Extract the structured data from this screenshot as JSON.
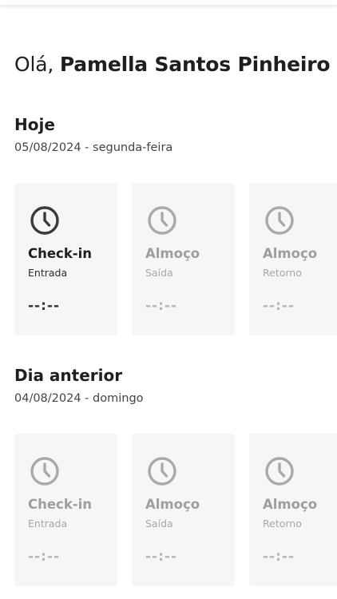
{
  "greeting": {
    "prefix": "Olá, ",
    "name": "Pamella Santos Pinheiro"
  },
  "today": {
    "title": "Hoje",
    "date": "05/08/2024 - segunda-feira",
    "cards": [
      {
        "label": "Check-in",
        "sublabel": "Entrada",
        "time": "--:--",
        "icon": "clock-icon",
        "state": "active"
      },
      {
        "label": "Almoço",
        "sublabel": "Saída",
        "time": "--:--",
        "icon": "clock-icon",
        "state": "muted"
      },
      {
        "label": "Almoço",
        "sublabel": "Retorno",
        "time": "--:--",
        "icon": "clock-icon",
        "state": "muted"
      }
    ]
  },
  "previous": {
    "title": "Dia anterior",
    "date": "04/08/2024 - domingo",
    "cards": [
      {
        "label": "Check-in",
        "sublabel": "Entrada",
        "time": "--:--",
        "icon": "clock-icon",
        "state": "muted"
      },
      {
        "label": "Almoço",
        "sublabel": "Saída",
        "time": "--:--",
        "icon": "clock-icon",
        "state": "muted"
      },
      {
        "label": "Almoço",
        "sublabel": "Retorno",
        "time": "--:--",
        "icon": "clock-icon",
        "state": "muted"
      }
    ]
  },
  "colors": {
    "active_icon": "#3a3a3a",
    "muted_icon": "#a9a9a9",
    "card_background": "#f6f6f6"
  }
}
